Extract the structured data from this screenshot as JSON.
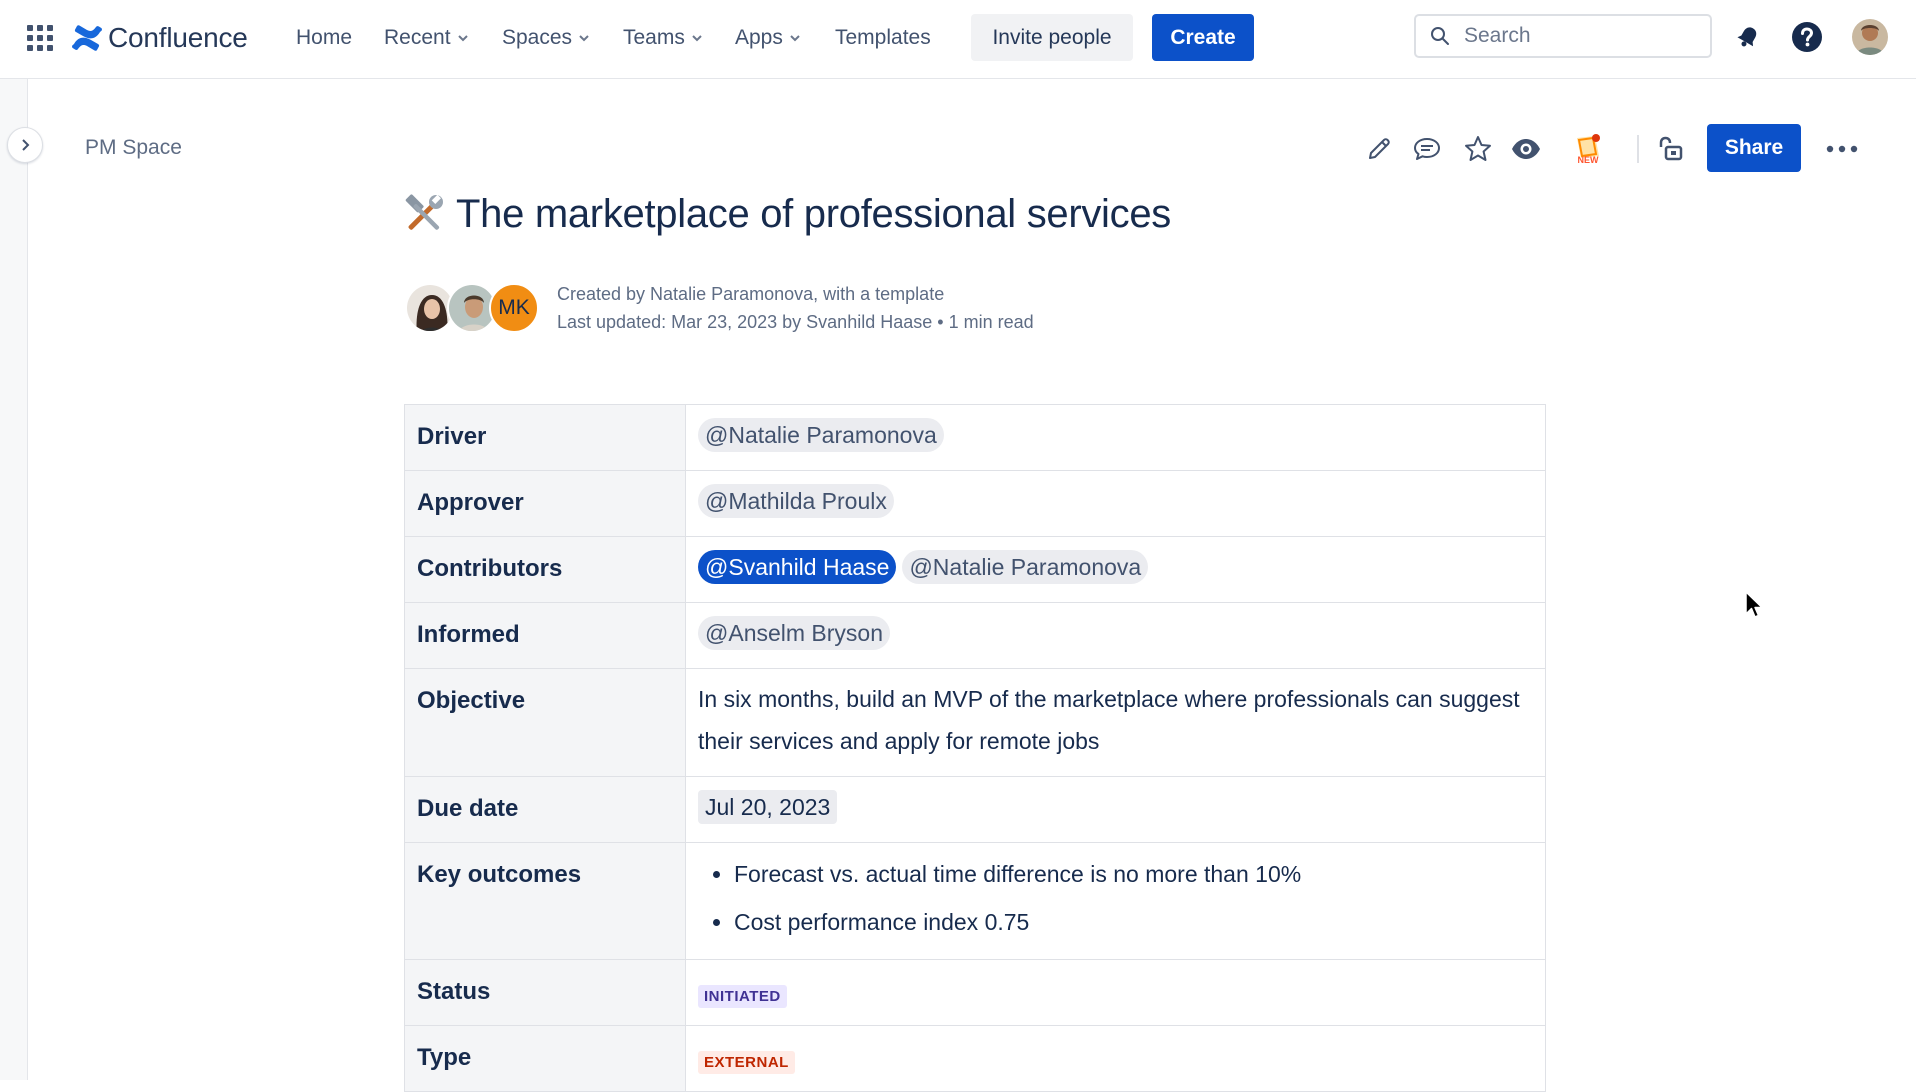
{
  "topnav": {
    "brand": "Confluence",
    "items": [
      {
        "label": "Home",
        "has_dropdown": false
      },
      {
        "label": "Recent",
        "has_dropdown": true
      },
      {
        "label": "Spaces",
        "has_dropdown": true
      },
      {
        "label": "Teams",
        "has_dropdown": true
      },
      {
        "label": "Apps",
        "has_dropdown": true
      },
      {
        "label": "Templates",
        "has_dropdown": false
      }
    ],
    "invite_label": "Invite people",
    "create_label": "Create",
    "search_placeholder": "Search"
  },
  "breadcrumb": "PM Space",
  "toolbar": {
    "share_label": "Share",
    "new_badge": "NEW"
  },
  "page": {
    "emoji": "🛠️",
    "title": "The marketplace of professional services",
    "byline_created": "Created by Natalie Paramonova, with a template",
    "byline_updated": "Last updated: Mar 23, 2023 by Svanhild Haase",
    "read_time": "1 min read",
    "avatar_initials": "MK"
  },
  "properties": {
    "driver_label": "Driver",
    "driver": "@Natalie Paramonova",
    "approver_label": "Approver",
    "approver": "@Mathilda Proulx",
    "contributors_label": "Contributors",
    "contributor_1": "@Svanhild Haase",
    "contributor_2": "@Natalie Paramonova",
    "informed_label": "Informed",
    "informed": "@Anselm Bryson",
    "objective_label": "Objective",
    "objective": "In six months, build an MVP of the marketplace where professionals can suggest their services and apply for remote jobs",
    "due_label": "Due date",
    "due": "Jul 20, 2023",
    "outcomes_label": "Key outcomes",
    "outcome_1": "Forecast vs. actual time difference is no more than 10%",
    "outcome_2": "Cost performance index 0.75",
    "status_label": "Status",
    "status": "INITIATED",
    "type_label": "Type",
    "type": "EXTERNAL"
  },
  "colors": {
    "primary": "#0c51c9",
    "text": "#172b4d",
    "status_initiated_bg": "#eae6ff",
    "status_external_fg": "#bf2600"
  }
}
